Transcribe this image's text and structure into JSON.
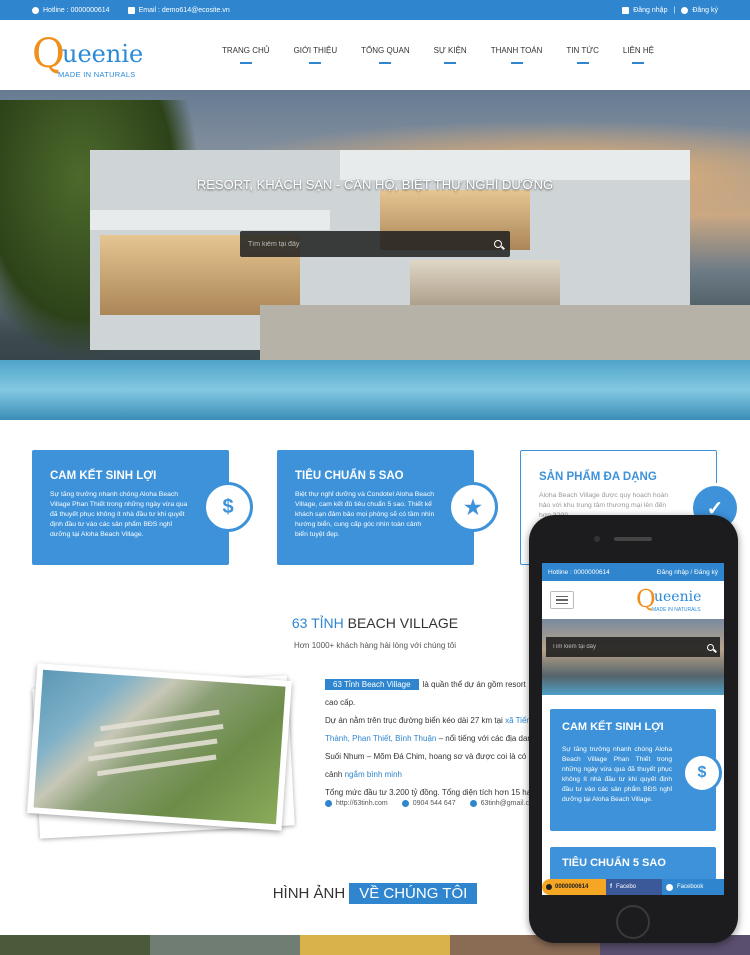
{
  "topbar": {
    "hotline": "Hotline : 0000000614",
    "email": "Email : demo614@ecosite.vn",
    "login": "Đăng nhập",
    "register": "Đăng ký"
  },
  "logo": {
    "q": "Q",
    "rest": "ueenie",
    "tagline": "MADE IN NATURALS"
  },
  "nav": [
    "TRANG CHỦ",
    "GIỚI THIỆU",
    "TỔNG QUAN",
    "SỰ KIỆN",
    "THANH TOÁN",
    "TIN TỨC",
    "LIÊN HỆ"
  ],
  "hero": {
    "title": "RESORT, KHÁCH SẠN - CĂN HỘ, BIỆT THỰ NGHỈ DƯỠNG",
    "search_placeholder": "Tìm kiếm tại đây"
  },
  "cards": [
    {
      "title": "CAM KẾT SINH LỢI",
      "text": "Sự tăng trưởng nhanh chóng Aloha Beach Village Phan Thiết trong những ngày vừa qua đã thuyết phục không ít nhà đầu tư khi quyết định đầu tư vào các sản phẩm BĐS nghỉ dưỡng tại Aloha Beach Village.",
      "badge": "$"
    },
    {
      "title": "TIÊU CHUẨN 5 SAO",
      "text": "Biệt thự nghỉ dưỡng và Condotel Aloha Beach Village, cam kết đủ tiêu chuẩn 5 sao. Thiết kế khách sạn đảm bảo mọi phòng sẽ có tầm nhìn hướng biển, cung cấp góc nhìn toàn cảnh biển tuyệt đẹp.",
      "badge": "★"
    },
    {
      "title": "SẢN PHẨM ĐA DẠNG",
      "text": "Aloha Beach Village được quy hoạch hoàn hảo với khu trung tâm thương mại lên đến hơn 3200",
      "badge": "✓"
    }
  ],
  "section": {
    "title_hl": "63 TỈNH",
    "title_rest": " BEACH VILLAGE",
    "subtitle": "Hơn 1000+ khách hàng hài lòng với chúng tôi",
    "tag": "63 Tỉnh Beach Village",
    "p1": "là quần thể dự án gồm resort cao cấp.",
    "p2a": "Dự án nằm trên trục đường biển kéo dài 27 km tại",
    "p2link": "xã Tiến Thành, Phan Thiết, Bình Thuận",
    "p2b": "– nổi tiếng với các địa danh Suối Nhum – Mõm Đá Chim, hoang sơ và được coi là có cảnh",
    "p2link2": "ngắm bình minh",
    "p3": "Tổng mức đầu tư 3.200 tỷ đồng. Tổng diện tích hơn 15 ha.",
    "website": "http://63tinh.com",
    "phone": "0904 544 647",
    "mail": "63tinh@gmail.com"
  },
  "gallery": {
    "title": "HÌNH ẢNH",
    "title_box": "VỀ CHÚNG TÔI"
  },
  "mobile": {
    "hotline": "Hotline : 0000000614",
    "auth": "Đăng nhập / Đăng ký",
    "search_placeholder": "Tìm kiếm tại đây",
    "card1_title": "CAM KẾT SINH LỢI",
    "card1_text": "Sự tăng trưởng nhanh chóng Aloha Beach Village Phan Thiết trong những ngày vừa qua đã thuyết phục không ít nhà đầu tư khi quyết định đầu tư vào các sản phẩm BĐS nghỉ dưỡng tại Aloha Beach Village.",
    "card1_badge": "$",
    "card2_title": "TIÊU CHUẨN 5 SAO",
    "bottom_phone": "0000000614",
    "bottom_fb": "Facebo",
    "bottom_msg": "Facebook"
  },
  "colors": {
    "primary": "#2f86cf",
    "accent": "#f08f1c"
  }
}
